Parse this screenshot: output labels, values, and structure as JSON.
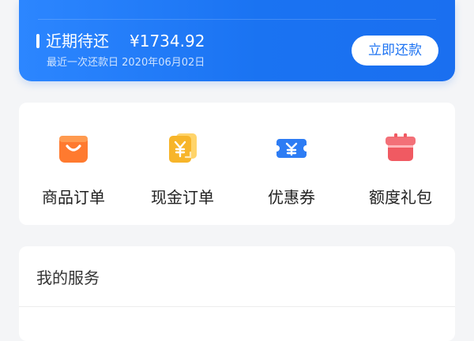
{
  "repayment": {
    "due_label": "近期待还",
    "due_amount": "¥1734.92",
    "last_repay_text": "最近一次还款日 2020年06月02日",
    "repay_button": "立即还款"
  },
  "orders": [
    {
      "label": "商品订单",
      "icon": "shopping-bag-icon"
    },
    {
      "label": "现金订单",
      "icon": "cash-document-icon"
    },
    {
      "label": "优惠券",
      "icon": "coupon-icon"
    },
    {
      "label": "额度礼包",
      "icon": "gift-icon"
    }
  ],
  "services": {
    "title": "我的服务"
  },
  "colors": {
    "brand_blue": "#1a73f2",
    "orange": "#ff7a2f",
    "yellow": "#f7b52a",
    "coupon_blue": "#2d7cf4",
    "red": "#f05a62"
  }
}
